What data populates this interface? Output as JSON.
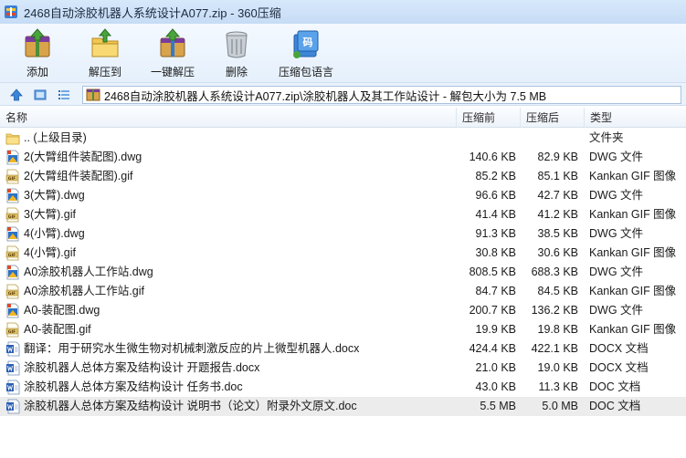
{
  "window": {
    "title": "2468自动涂胶机器人系统设计A077.zip - 360压缩"
  },
  "toolbar": {
    "buttons": [
      {
        "label": "添加",
        "icon": "add-archive-icon"
      },
      {
        "label": "解压到",
        "icon": "extract-to-icon"
      },
      {
        "label": "一键解压",
        "icon": "one-click-extract-icon"
      },
      {
        "label": "删除",
        "icon": "trash-bin-icon"
      },
      {
        "label": "压缩包语言",
        "icon": "archive-language-icon"
      }
    ]
  },
  "address": {
    "path": "2468自动涂胶机器人系统设计A077.zip\\涂胶机器人及其工作站设计 - 解包大小为 7.5 MB"
  },
  "columns": {
    "name": "名称",
    "original": "压缩前",
    "compressed": "压缩后",
    "type": "类型"
  },
  "files": [
    {
      "name": ".. (上级目录)",
      "original": "",
      "compressed": "",
      "type": "文件夹",
      "icon": "folder-icon"
    },
    {
      "name": "2(大臂组件装配图).dwg",
      "original": "140.6 KB",
      "compressed": "82.9 KB",
      "type": "DWG 文件",
      "icon": "dwg-file-icon"
    },
    {
      "name": "2(大臂组件装配图).gif",
      "original": "85.2 KB",
      "compressed": "85.1 KB",
      "type": "Kankan GIF 图像",
      "icon": "gif-file-icon"
    },
    {
      "name": "3(大臂).dwg",
      "original": "96.6 KB",
      "compressed": "42.7 KB",
      "type": "DWG 文件",
      "icon": "dwg-file-icon"
    },
    {
      "name": "3(大臂).gif",
      "original": "41.4 KB",
      "compressed": "41.2 KB",
      "type": "Kankan GIF 图像",
      "icon": "gif-file-icon"
    },
    {
      "name": "4(小臂).dwg",
      "original": "91.3 KB",
      "compressed": "38.5 KB",
      "type": "DWG 文件",
      "icon": "dwg-file-icon"
    },
    {
      "name": "4(小臂).gif",
      "original": "30.8 KB",
      "compressed": "30.6 KB",
      "type": "Kankan GIF 图像",
      "icon": "gif-file-icon"
    },
    {
      "name": "A0涂胶机器人工作站.dwg",
      "original": "808.5 KB",
      "compressed": "688.3 KB",
      "type": "DWG 文件",
      "icon": "dwg-file-icon"
    },
    {
      "name": "A0涂胶机器人工作站.gif",
      "original": "84.7 KB",
      "compressed": "84.5 KB",
      "type": "Kankan GIF 图像",
      "icon": "gif-file-icon"
    },
    {
      "name": "A0-装配图.dwg",
      "original": "200.7 KB",
      "compressed": "136.2 KB",
      "type": "DWG 文件",
      "icon": "dwg-file-icon"
    },
    {
      "name": "A0-装配图.gif",
      "original": "19.9 KB",
      "compressed": "19.8 KB",
      "type": "Kankan GIF 图像",
      "icon": "gif-file-icon"
    },
    {
      "name": "翻译：用于研究水生微生物对机械刺激反应的片上微型机器人.docx",
      "original": "424.4 KB",
      "compressed": "422.1 KB",
      "type": "DOCX 文档",
      "icon": "word-doc-icon"
    },
    {
      "name": "涂胶机器人总体方案及结构设计 开题报告.docx",
      "original": "21.0 KB",
      "compressed": "19.0 KB",
      "type": "DOCX 文档",
      "icon": "word-doc-icon"
    },
    {
      "name": "涂胶机器人总体方案及结构设计 任务书.doc",
      "original": "43.0 KB",
      "compressed": "11.3 KB",
      "type": "DOC 文档",
      "icon": "word-doc-icon"
    },
    {
      "name": "涂胶机器人总体方案及结构设计 说明书（论文）附录外文原文.doc",
      "original": "5.5 MB",
      "compressed": "5.0 MB",
      "type": "DOC 文档",
      "icon": "word-doc-icon",
      "selected": true
    }
  ]
}
